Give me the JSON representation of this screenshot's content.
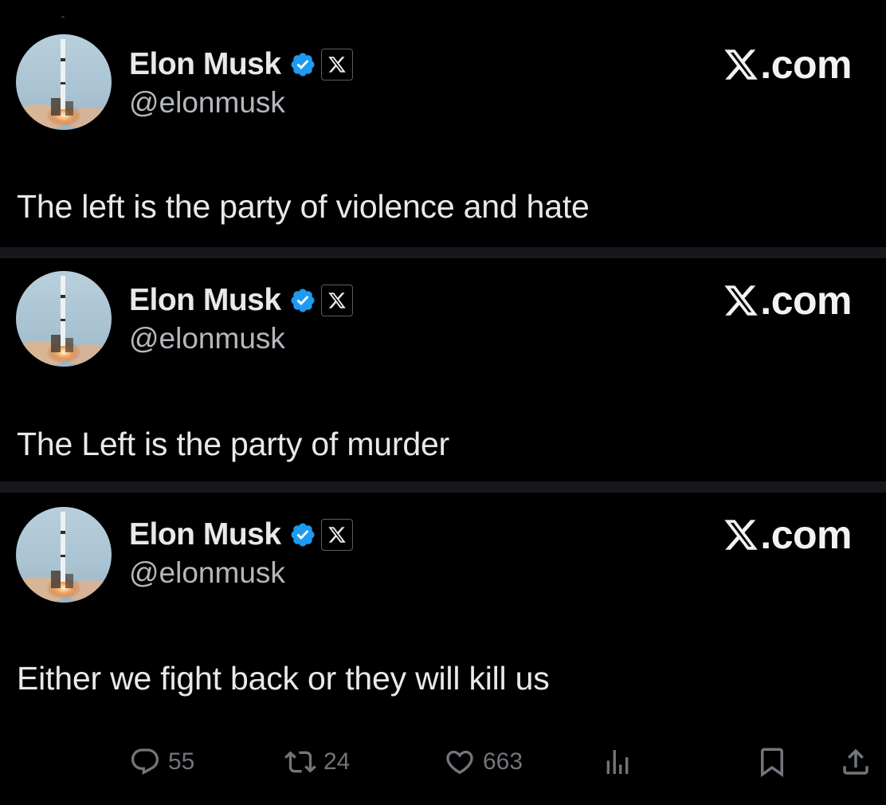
{
  "author": {
    "name": "Elon Musk",
    "handle": "@elonmusk"
  },
  "brand": {
    "domain": ".com"
  },
  "colors": {
    "background": "#000000",
    "separator": "#16181c",
    "text": "#e7e9ea",
    "muted": "#71767b",
    "verified_blue": "#1d9bf0"
  },
  "posts": [
    {
      "text": "The left is the party of violence and hate"
    },
    {
      "text": "The Left is the party of murder"
    },
    {
      "text": "Either we fight back or they will kill us"
    }
  ],
  "actions": {
    "replies": "55",
    "reposts": "24",
    "likes": "663",
    "icons": [
      "reply-icon",
      "repost-icon",
      "like-icon",
      "views-icon",
      "bookmark-icon",
      "share-icon"
    ]
  }
}
